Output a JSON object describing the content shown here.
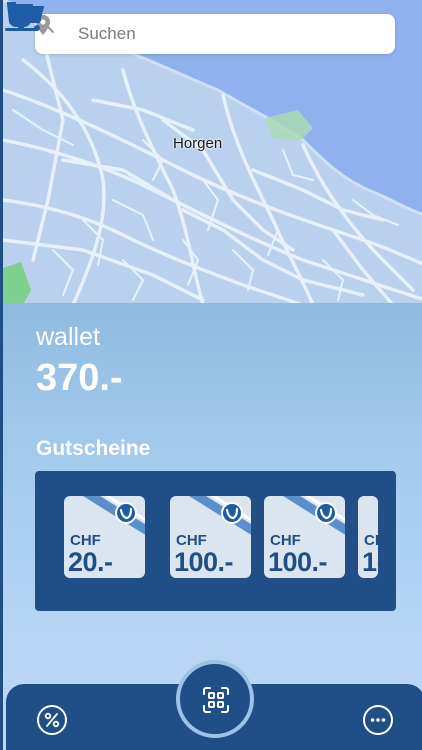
{
  "search": {
    "placeholder": "Suchen"
  },
  "map": {
    "place_label": "Horgen"
  },
  "wallet": {
    "label": "wallet",
    "amount": "370.-"
  },
  "vouchers": {
    "heading": "Gutscheine",
    "items": [
      {
        "currency": "CHF",
        "value": "20.-"
      },
      {
        "currency": "CHF",
        "value": "100.-"
      },
      {
        "currency": "CHF",
        "value": "100.-"
      },
      {
        "currency": "CH",
        "value": "1("
      }
    ]
  },
  "icons": {
    "search": "search-icon",
    "location_pin": "location-pin-icon",
    "cart_marker": "shopping-cart-icon",
    "cafe_marker": "coffee-cup-icon",
    "voucher_badge": "brand-logo-icon",
    "scan": "qr-scan-icon",
    "percent": "percent-icon",
    "more": "more-dots-icon"
  },
  "colors": {
    "brand_navy": "#1f4f86",
    "map_land": "#b9d0ef",
    "map_water": "#8fb2ef",
    "map_park": "#7fd08f",
    "panel_top": "#8fbbe0",
    "voucher_card": "#dbe5f0"
  }
}
